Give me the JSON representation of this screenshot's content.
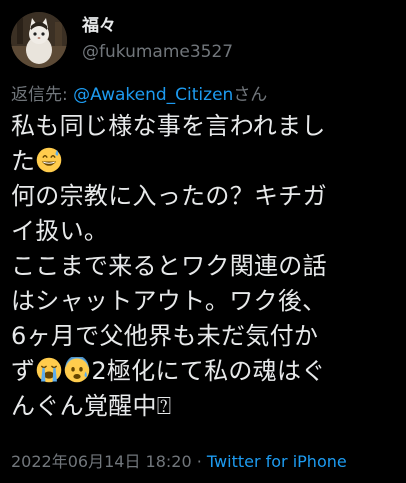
{
  "user": {
    "display_name": "福々",
    "handle": "@fukumame3527"
  },
  "reply": {
    "prefix": "返信先: ",
    "mention": "@Awakend_Citizen",
    "suffix": "さん"
  },
  "tweet": {
    "line1": "私も同じ様な事を言われまし",
    "line2": "た",
    "line3": "何の宗教に入ったの？キチガ",
    "line4": "イ扱い。",
    "line5": "ここまで来るとワク関連の話",
    "line6": "はシャットアウト。ワク後、",
    "line7": "6ヶ月で父他界も未だ気付か",
    "line8a": "ず",
    "line8b": "2極化にて私の魂はぐ",
    "line9": "んぐん覚醒中⍰"
  },
  "meta": {
    "timestamp": "2022年06月14日 18:20",
    "separator": " · ",
    "source": "Twitter for iPhone"
  },
  "colors": {
    "background": "#000000",
    "text": "#e7e9ea",
    "secondary": "#71767b",
    "link": "#1d9bf0"
  },
  "icons": {
    "avatar": "cat-photo",
    "emoji_1": "grinning-face-with-sweat",
    "emoji_2": "loudly-crying-face",
    "emoji_3": "anxious-face-with-sweat"
  }
}
